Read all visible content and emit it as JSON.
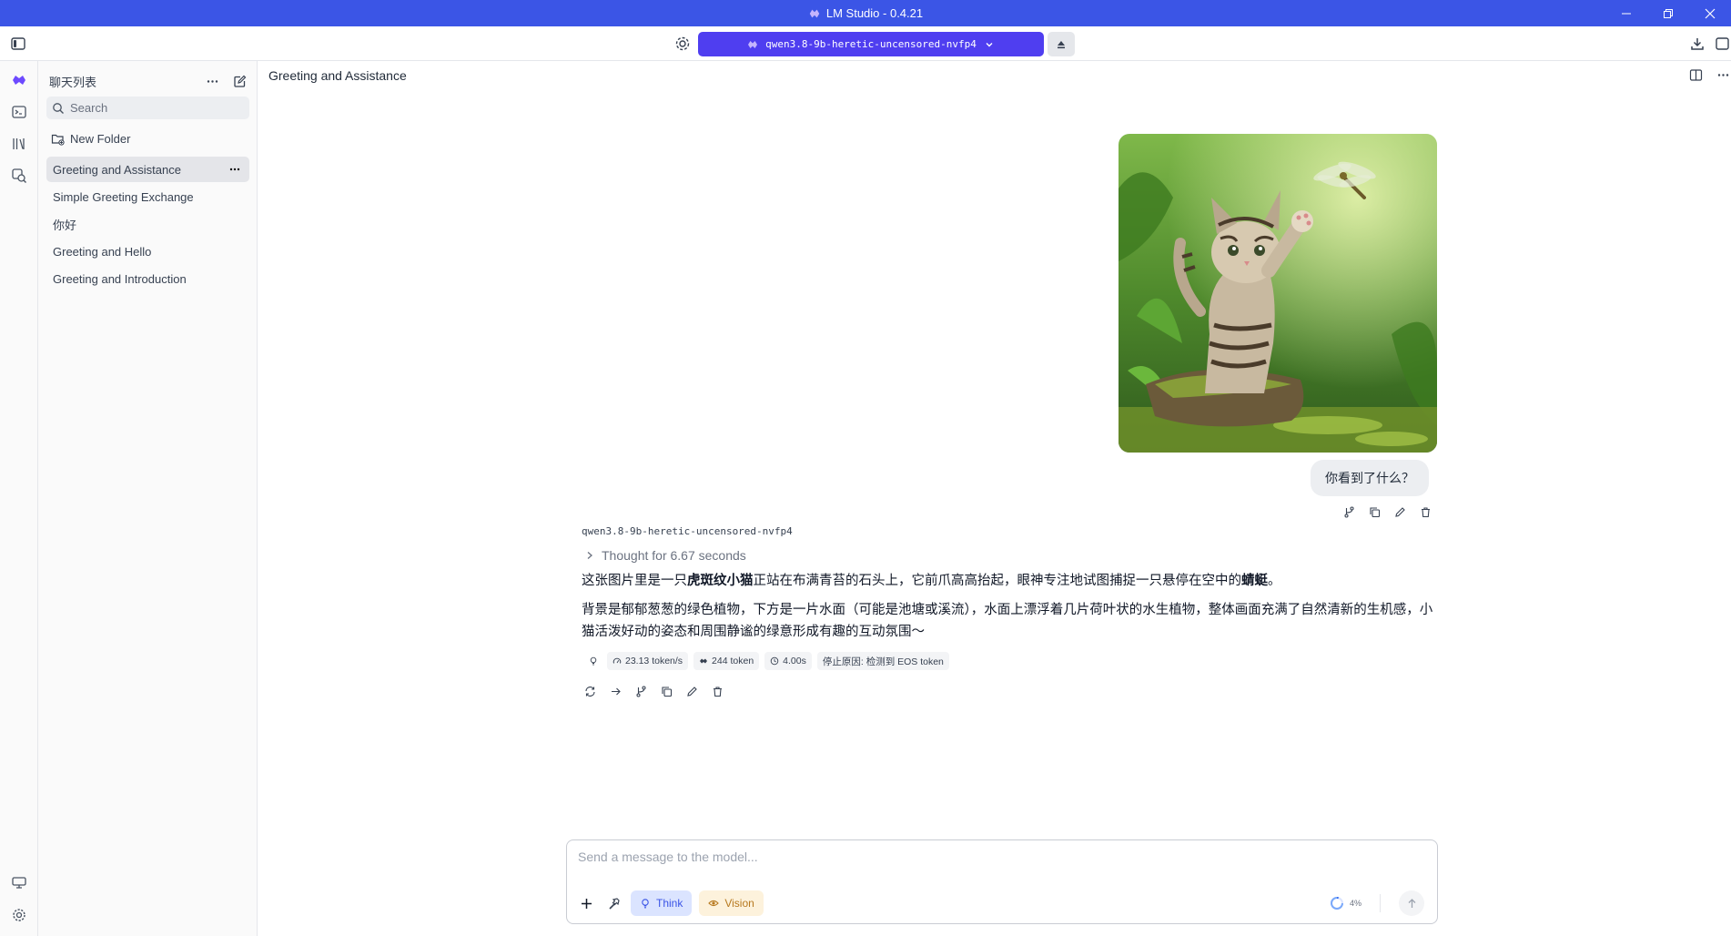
{
  "window": {
    "title": "LM Studio - 0.4.21",
    "controls": [
      "minimize-icon",
      "restore-icon",
      "close-icon"
    ]
  },
  "toolbar": {
    "model_name": "qwen3.8-9b-heretic-uncensored-nvfp4",
    "icons": [
      "sidebar-toggle-icon",
      "settings-sliders-icon",
      "eject-icon",
      "download-icon",
      "panel-icon"
    ]
  },
  "rail": {
    "top_icons": [
      "chat-icon",
      "terminal-icon",
      "models-icon",
      "search-models-icon"
    ],
    "bottom_icons": [
      "hardware-icon",
      "settings-icon"
    ]
  },
  "sidebar": {
    "header_label": "聊天列表",
    "search_placeholder": "Search",
    "new_folder_label": "New Folder",
    "chats": [
      {
        "label": "Greeting and Assistance",
        "active": true
      },
      {
        "label": "Simple Greeting Exchange",
        "active": false
      },
      {
        "label": "你好",
        "active": false
      },
      {
        "label": "Greeting and Hello",
        "active": false
      },
      {
        "label": "Greeting and Introduction",
        "active": false
      }
    ]
  },
  "main": {
    "chat_title": "Greeting and Assistance",
    "user_message": {
      "text": "你看到了什么？",
      "image_alt": "kitten reaching for a dragonfly"
    },
    "assistant": {
      "model_tag": "qwen3.8-9b-heretic-uncensored-nvfp4",
      "thought_label": "Thought for 6.67 seconds",
      "para1": {
        "a": "这张图片里是一只",
        "b_bold": "虎斑纹小猫",
        "c": "正站在布满青苔的石头上，它前爪高高抬起，眼神专注地试图捕捉一只悬停在空中的",
        "d_bold": "蜻蜓",
        "e": "。"
      },
      "para2": "背景是郁郁葱葱的绿色植物，下方是一片水面（可能是池塘或溪流），水面上漂浮着几片荷叶状的水生植物，整体画面充满了自然清新的生机感，小猫活泼好动的姿态和周围静谧的绿意形成有趣的互动氛围～",
      "stats": {
        "speed": "23.13 token/s",
        "tokens": "244 token",
        "time": "4.00s",
        "stop_reason": "停止原因: 检测到 EOS token"
      }
    }
  },
  "composer": {
    "placeholder": "Send a message to the model...",
    "think_label": "Think",
    "vision_label": "Vision",
    "context_usage": "4%"
  },
  "colors": {
    "accent": "#3b55e6",
    "model_pill": "#4f3ef0",
    "think_chip": "#dbe4ff",
    "vision_chip": "#fdf2dc"
  }
}
